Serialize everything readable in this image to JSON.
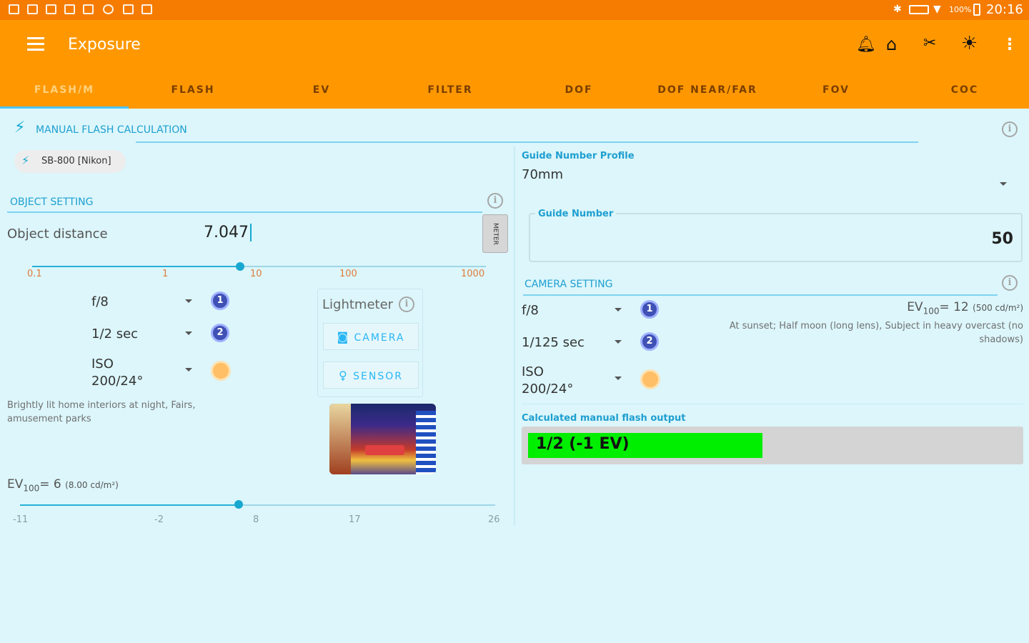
{
  "statusbar": {
    "battery": "100%",
    "time": "20:16"
  },
  "appbar": {
    "title": "Exposure"
  },
  "tabs": [
    "FLASH/M",
    "FLASH",
    "EV",
    "FILTER",
    "DOF",
    "DOF NEAR/FAR",
    "FOV",
    "COC"
  ],
  "section": {
    "manual_flash": "MANUAL FLASH CALCULATION"
  },
  "flash": {
    "chip_label": "SB-800 [Nikon]"
  },
  "object": {
    "section": "OBJECT SETTING",
    "distance_label": "Object distance",
    "distance_value": "7.047",
    "unit_label": "METER",
    "slider_ticks": [
      "0.1",
      "1",
      "10",
      "100",
      "1000"
    ]
  },
  "exposure_left": {
    "aperture": "f/8",
    "shutter": "1/2 sec",
    "iso_line1": "ISO",
    "iso_line2": "200/24°",
    "num1": "1",
    "num2": "2"
  },
  "lightmeter": {
    "title": "Lightmeter",
    "camera_button": "CAMERA",
    "sensor_button": "SENSOR"
  },
  "scene_desc": "Brightly lit home interiors at night, Fairs, amusement parks",
  "ev_left": {
    "label": "EV",
    "sub": "100",
    "value": "= 6",
    "unit": "(8.00 cd/m²)",
    "ticks": [
      "-11",
      "-2",
      "8",
      "17",
      "26"
    ]
  },
  "guide": {
    "profile_label": "Guide Number Profile",
    "profile_value": "70mm",
    "number_label": "Guide Number",
    "number_value": "50"
  },
  "camera": {
    "section": "CAMERA SETTING",
    "aperture": "f/8",
    "shutter": "1/125 sec",
    "iso_line1": "ISO",
    "iso_line2": "200/24°",
    "num1": "1",
    "num2": "2",
    "ev_label": "EV",
    "ev_sub": "100",
    "ev_value": "= 12",
    "ev_unit": "(500 cd/m²)",
    "ev_desc": "At sunset; Half moon (long lens), Subject in heavy overcast (no shadows)"
  },
  "output": {
    "label": "Calculated manual flash output",
    "value": "1/2 (-1 EV)",
    "fraction": 0.48
  },
  "colors": {
    "accent": "#ff9800",
    "statusbar": "#f57c00",
    "background": "#dcf6fb",
    "output_bar": "#00ee00"
  }
}
